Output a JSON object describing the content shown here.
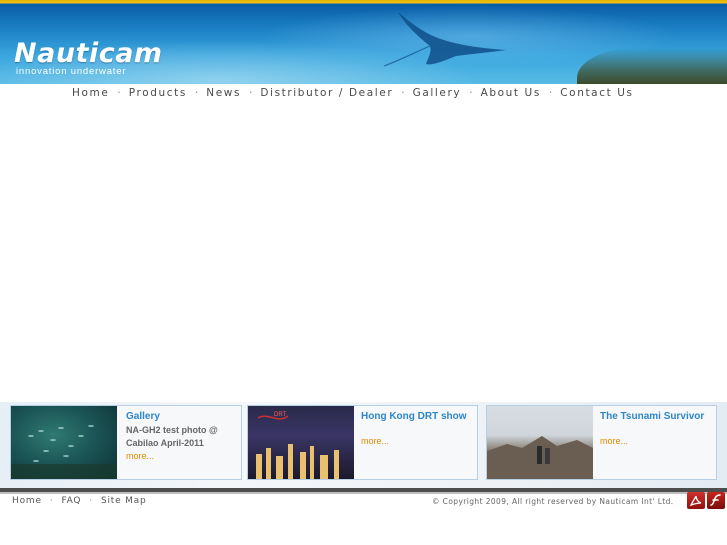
{
  "header": {
    "logo_text": "Nauticam",
    "tagline": "innovation underwater"
  },
  "nav": {
    "items": [
      {
        "label": "Home"
      },
      {
        "label": "Products"
      },
      {
        "label": "News"
      },
      {
        "label": "Distributor / Dealer"
      },
      {
        "label": "Gallery"
      },
      {
        "label": "About Us"
      },
      {
        "label": "Contact Us"
      }
    ],
    "separator": "·"
  },
  "news": [
    {
      "title": "Gallery",
      "desc_line1": "NA-GH2 test photo @",
      "desc_line2": "Cabilao April-2011",
      "more": "more..."
    },
    {
      "title": "Hong Kong DRT show",
      "more": "more..."
    },
    {
      "title": "The Tsunami Survivor",
      "more": "more..."
    }
  ],
  "footer": {
    "links": [
      "Home",
      "FAQ",
      "Site Map"
    ],
    "separator": "·",
    "copyright": "© Copyright 2009, All right reserved by Nauticam Int' Ltd.",
    "icons": [
      "pdf-icon",
      "flash-icon"
    ]
  },
  "colors": {
    "accent_blue": "#2e86c8",
    "more_orange": "#e08a00",
    "banner_top": "#f2c21a"
  }
}
